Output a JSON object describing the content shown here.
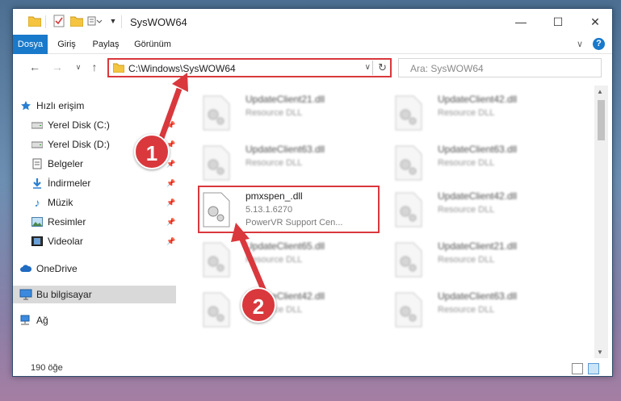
{
  "window": {
    "title": "SysWOW64",
    "minimize": "—",
    "maximize": "☐",
    "close": "✕"
  },
  "ribbon": {
    "tabs": [
      "Dosya",
      "Giriş",
      "Paylaş",
      "Görünüm"
    ],
    "expand": "∨",
    "help": "?"
  },
  "address": {
    "path": "C:\\Windows\\SysWOW64",
    "search_placeholder": "Ara: SysWOW64"
  },
  "nav": {
    "quick_access": "Hızlı erişim",
    "items": [
      "Yerel Disk (C:)",
      "Yerel Disk (D:)",
      "Belgeler",
      "İndirmeler",
      "Müzik",
      "Resimler",
      "Videolar"
    ],
    "onedrive": "OneDrive",
    "this_pc": "Bu bilgisayar",
    "network": "Ağ"
  },
  "files": {
    "left": [
      {
        "name": "UpdateClient21.dll",
        "type": "Resource DLL"
      },
      {
        "name": "UpdateClient63.dll",
        "type": "Resource DLL"
      },
      {
        "name": "UpdateClient65.dll",
        "type": "Resource DLL"
      },
      {
        "name": "UpdateClient42.dll",
        "type": "Resource DLL"
      }
    ],
    "right": [
      {
        "name": "UpdateClient42.dll",
        "type": "Resource DLL"
      },
      {
        "name": "UpdateClient63.dll",
        "type": "Resource DLL"
      },
      {
        "name": "UpdateClient42.dll",
        "type": "Resource DLL"
      },
      {
        "name": "UpdateClient21.dll",
        "type": "Resource DLL"
      },
      {
        "name": "UpdateClient63.dll",
        "type": "Resource DLL"
      }
    ],
    "selected": {
      "name": "pmxspen_.dll",
      "version": "5.13.1.6270",
      "description": "PowerVR Support Cen..."
    }
  },
  "status": {
    "count": "190 öğe"
  },
  "annotations": {
    "step1": "1",
    "step2": "2"
  },
  "colors": {
    "accent": "#1979ca",
    "highlight": "#d9383d",
    "folder": "#f5c542"
  }
}
